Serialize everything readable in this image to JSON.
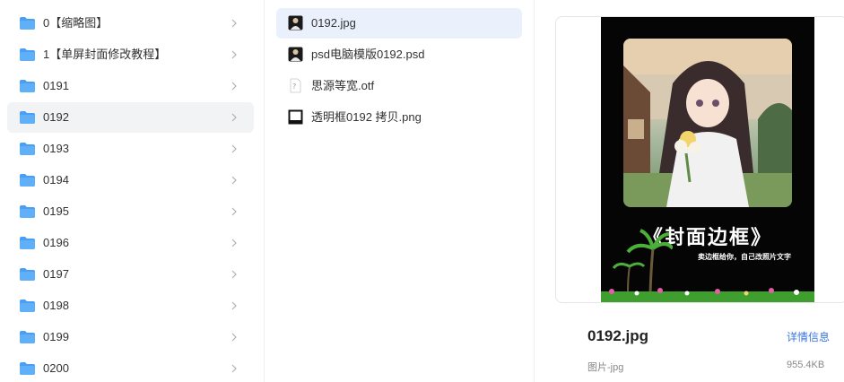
{
  "folders": [
    {
      "label": "0【缩略图】"
    },
    {
      "label": "1【单屏封面修改教程】"
    },
    {
      "label": "0191"
    },
    {
      "label": "0192"
    },
    {
      "label": "0193"
    },
    {
      "label": "0194"
    },
    {
      "label": "0195"
    },
    {
      "label": "0196"
    },
    {
      "label": "0197"
    },
    {
      "label": "0198"
    },
    {
      "label": "0199"
    },
    {
      "label": "0200"
    }
  ],
  "files": [
    {
      "label": "0192.jpg",
      "icon": "image-file-icon"
    },
    {
      "label": "psd电脑模版0192.psd",
      "icon": "psd-file-icon"
    },
    {
      "label": "思源等宽.otf",
      "icon": "font-file-icon"
    },
    {
      "label": "透明框0192 拷贝.png",
      "icon": "png-file-icon"
    }
  ],
  "preview": {
    "poster_title": "《封面边框》",
    "poster_subtitle": "卖边框给你，自己改照片文字",
    "file_name": "0192.jpg",
    "detail_link": "详情信息",
    "file_type": "图片-jpg",
    "file_size": "955.4KB"
  },
  "colors": {
    "folder": "#4a9ff5",
    "selected_folder_bg": "#f2f3f5",
    "selected_file_bg": "#eaf1fd",
    "link": "#3a77d9"
  }
}
